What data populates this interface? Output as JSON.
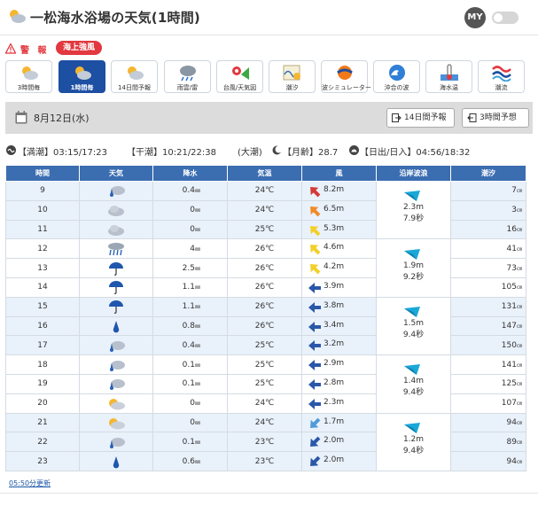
{
  "header": {
    "title": "一松海水浴場の天気(1時間)",
    "my_label": "MY"
  },
  "warning": {
    "label": "警 報",
    "badge": "海上強風"
  },
  "tabs": [
    {
      "label": "3時間毎",
      "icon": "sun-cloud-icon"
    },
    {
      "label": "1時間毎",
      "icon": "sun-cloud-icon"
    },
    {
      "label": "14日間予報",
      "icon": "sun-cloud-icon"
    },
    {
      "label": "雨雲/雷",
      "icon": "rain-cloud-icon"
    },
    {
      "label": "台風/天気図",
      "icon": "typhoon-map-icon"
    },
    {
      "label": "潮汐",
      "icon": "tide-chart-icon"
    },
    {
      "label": "波シミュレーター",
      "icon": "wave-ball-icon"
    },
    {
      "label": "沖合の波",
      "icon": "offshore-wave-icon"
    },
    {
      "label": "海水温",
      "icon": "sea-temperature-icon"
    },
    {
      "label": "潮流",
      "icon": "tidal-current-icon"
    }
  ],
  "datebar": {
    "date": "8月12日(水)",
    "btn14": "14日間予報",
    "btn3": "3時間予想"
  },
  "tideinfo": {
    "high": "【満潮】03:15/17:23",
    "low": "【干潮】10:21/22:38",
    "tide_type": "(大潮)",
    "moon": "【月齢】28.7",
    "sun": "【日出/日入】04:56/18:32"
  },
  "table": {
    "headers": [
      "時間",
      "天気",
      "降水",
      "気温",
      "風",
      "沿岸波浪",
      "潮汐"
    ],
    "precip_unit": "㎜",
    "tide_unit": "㎝",
    "rows": [
      {
        "hour": "9",
        "weather": "rain-cloud",
        "precip": "0.4",
        "temp": "24℃",
        "wind_dir": "red-nw",
        "wind": "8.2m",
        "tide": "7"
      },
      {
        "hour": "10",
        "weather": "cloud",
        "precip": "0",
        "temp": "24℃",
        "wind_dir": "orange-nw",
        "wind": "6.5m",
        "tide": "3"
      },
      {
        "hour": "11",
        "weather": "cloud",
        "precip": "0",
        "temp": "25℃",
        "wind_dir": "yellow-nw",
        "wind": "5.3m",
        "tide": "16"
      },
      {
        "hour": "12",
        "weather": "heavy-rain",
        "precip": "4",
        "temp": "26℃",
        "wind_dir": "yellow-nw",
        "wind": "4.6m",
        "tide": "41"
      },
      {
        "hour": "13",
        "weather": "umbrella",
        "precip": "2.5",
        "temp": "26℃",
        "wind_dir": "yellow-nw",
        "wind": "4.2m",
        "tide": "73"
      },
      {
        "hour": "14",
        "weather": "umbrella",
        "precip": "1.1",
        "temp": "26℃",
        "wind_dir": "blue-w",
        "wind": "3.9m",
        "tide": "105"
      },
      {
        "hour": "15",
        "weather": "umbrella",
        "precip": "1.1",
        "temp": "26℃",
        "wind_dir": "blue-w",
        "wind": "3.8m",
        "tide": "131"
      },
      {
        "hour": "16",
        "weather": "drop",
        "precip": "0.8",
        "temp": "26℃",
        "wind_dir": "blue-w",
        "wind": "3.4m",
        "tide": "147"
      },
      {
        "hour": "17",
        "weather": "rain-cloud",
        "precip": "0.4",
        "temp": "25℃",
        "wind_dir": "blue-w",
        "wind": "3.2m",
        "tide": "150"
      },
      {
        "hour": "18",
        "weather": "rain-cloud",
        "precip": "0.1",
        "temp": "25℃",
        "wind_dir": "blue-w",
        "wind": "2.9m",
        "tide": "141"
      },
      {
        "hour": "19",
        "weather": "rain-cloud",
        "precip": "0.1",
        "temp": "25℃",
        "wind_dir": "blue-w",
        "wind": "2.8m",
        "tide": "125"
      },
      {
        "hour": "20",
        "weather": "sun-cloud",
        "precip": "0",
        "temp": "24℃",
        "wind_dir": "blue-w",
        "wind": "2.3m",
        "tide": "107"
      },
      {
        "hour": "21",
        "weather": "sun-cloud",
        "precip": "0",
        "temp": "24℃",
        "wind_dir": "lightblue-sw",
        "wind": "1.7m",
        "tide": "94"
      },
      {
        "hour": "22",
        "weather": "rain-cloud",
        "precip": "0.1",
        "temp": "23℃",
        "wind_dir": "blue-sw",
        "wind": "2.0m",
        "tide": "89"
      },
      {
        "hour": "23",
        "weather": "drop",
        "precip": "0.6",
        "temp": "23℃",
        "wind_dir": "blue-sw",
        "wind": "2.0m",
        "tide": "94"
      }
    ],
    "waves": [
      {
        "height": "2.3m",
        "period": "7.9秒"
      },
      {
        "height": "1.9m",
        "period": "9.2秒"
      },
      {
        "height": "1.5m",
        "period": "9.4秒"
      },
      {
        "height": "1.4m",
        "period": "9.4秒"
      },
      {
        "height": "1.2m",
        "period": "9.4秒"
      }
    ]
  },
  "footer": {
    "updated": "05:50分更新"
  },
  "colors": {
    "header_blue": "#3b6db1",
    "active_tab": "#1d4fa3",
    "warning_red": "#e2383f",
    "row_blue": "#e9f1fb"
  }
}
